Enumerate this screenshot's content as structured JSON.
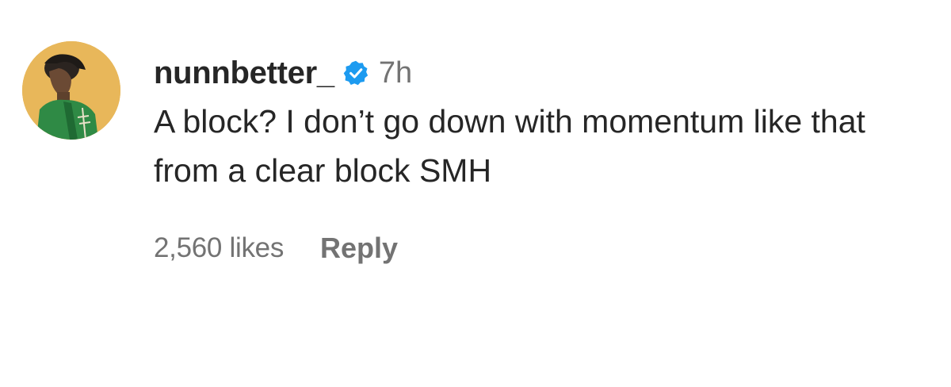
{
  "comment": {
    "avatar_icon": "user-avatar-photo",
    "username": "nunnbetter_",
    "verified_icon": "verified-badge-icon",
    "verified_color": "#1d9bf0",
    "time": "7h",
    "text": "A block? I don’t go down with momentum like that from a clear block SMH",
    "likes": "2,560 likes",
    "reply_label": "Reply"
  }
}
